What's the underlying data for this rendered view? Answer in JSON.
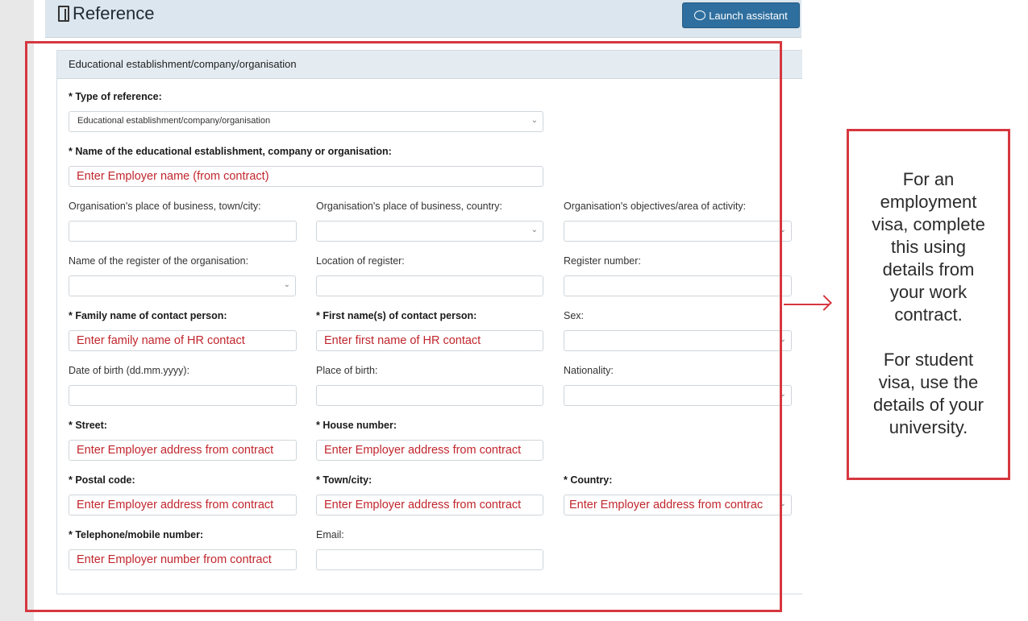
{
  "header": {
    "title": "Reference",
    "launch_label": "Launch assistant"
  },
  "panel": {
    "title": "Educational establishment/company/organisation"
  },
  "form": {
    "type_label": "* Type of reference:",
    "type_value": "Educational establishment/company/organisation",
    "name_label": "* Name of the educational establishment, company or organisation:",
    "name_value": "Enter Employer name (from contract)",
    "town_label": "Organisation's place of business, town/city:",
    "country_biz_label": "Organisation's place of business, country:",
    "objectives_label": "Organisation's objectives/area of activity:",
    "register_name_label": "Name of the register of the organisation:",
    "register_location_label": "Location of register:",
    "register_number_label": "Register number:",
    "family_label": "* Family name of contact person:",
    "family_value": "Enter family name of HR contact",
    "first_label": "* First name(s) of contact person:",
    "first_value": "Enter first name of HR contact",
    "sex_label": "Sex:",
    "dob_label": "Date of birth (dd.mm.yyyy):",
    "pob_label": "Place of birth:",
    "nationality_label": "Nationality:",
    "street_label": "* Street:",
    "street_value": "Enter Employer address from contract",
    "house_label": "* House number:",
    "house_value": "Enter Employer address from contract",
    "postal_label": "* Postal code:",
    "postal_value": "Enter Employer address from contract",
    "town_city_label": "* Town/city:",
    "town_city_value": "Enter Employer address from contract",
    "country_label": "* Country:",
    "country_value": "Enter Employer address from contrac",
    "phone_label": "* Telephone/mobile number:",
    "phone_value": "Enter Employer number from contract",
    "email_label": "Email:"
  },
  "annotation": {
    "lines1": [
      "For an",
      "employment",
      "visa, complete",
      "this using",
      "details from",
      "your work",
      "contract."
    ],
    "lines2": [
      "For student",
      "visa, use the",
      "details of your",
      "university."
    ]
  },
  "colors": {
    "annotation_red": "#d6373f",
    "placeholder_red": "#c0262d",
    "button_blue": "#2f6f9f"
  }
}
